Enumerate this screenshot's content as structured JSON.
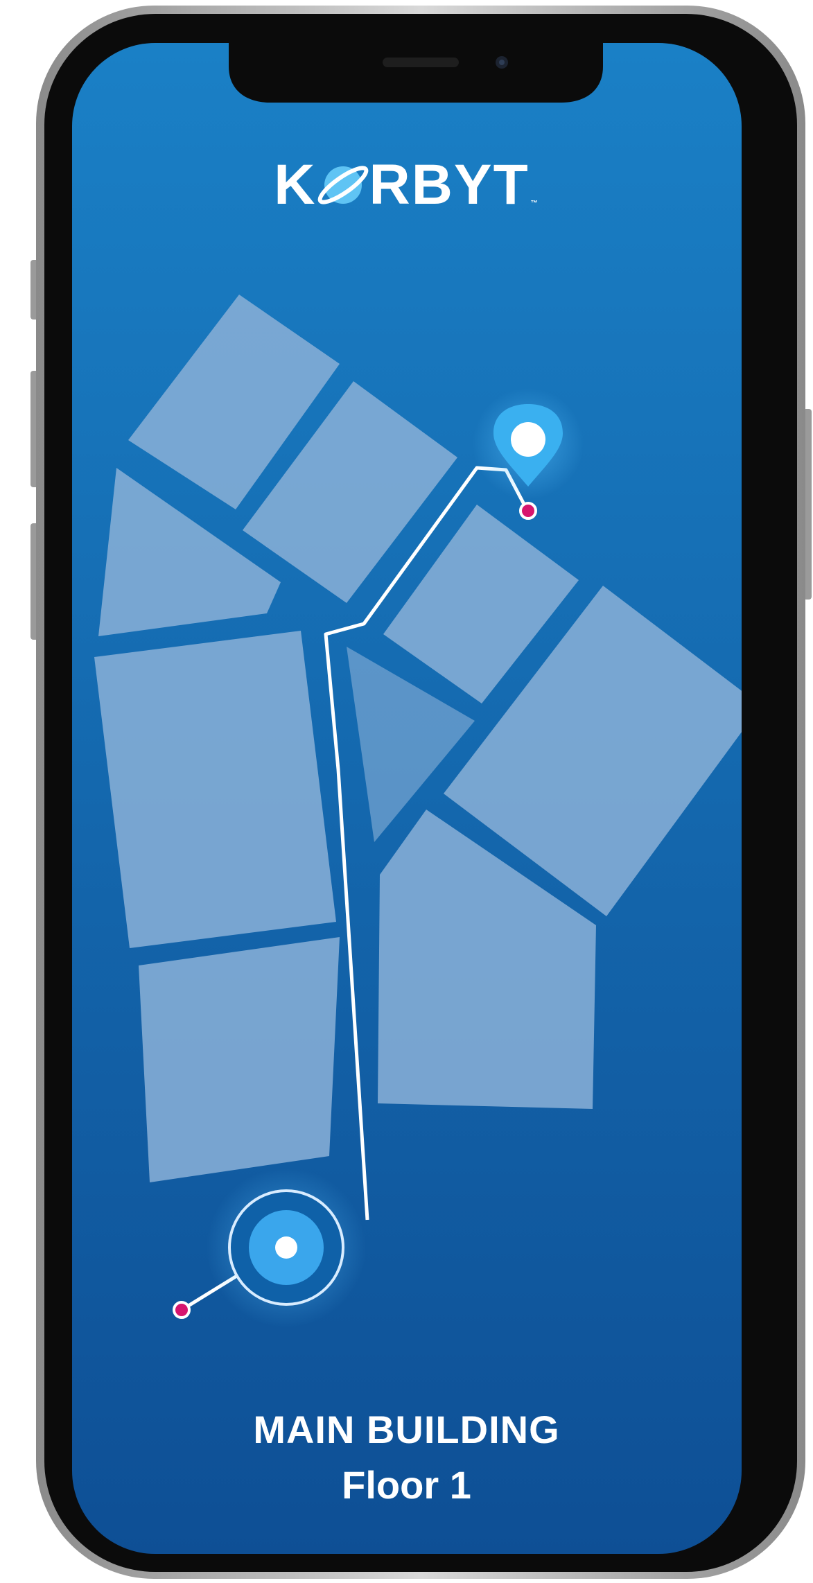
{
  "brand": {
    "logo_text_before": "K",
    "logo_text_after": "RBYT",
    "logo_trademark": "™",
    "logo_planet_icon": "planet-icon"
  },
  "map": {
    "destination_icon": "location-pin-icon",
    "current_location_icon": "current-location-icon",
    "route_color": "#ffffff",
    "endpoint_color": "#d6156e",
    "room_color": "#86aed6",
    "background_top": "#1a80c6",
    "background_bottom": "#0e4f95"
  },
  "building": {
    "name": "MAIN BUILDING",
    "floor": "Floor 1"
  }
}
